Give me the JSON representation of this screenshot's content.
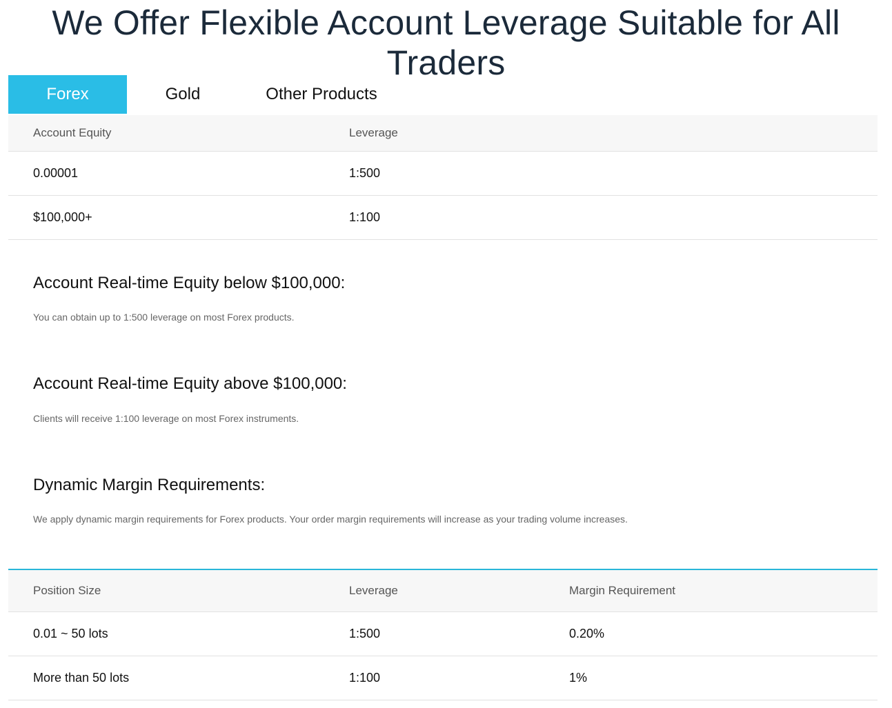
{
  "page": {
    "title": "We Offer Flexible Account Leverage Suitable for All Traders"
  },
  "tabs": [
    {
      "label": "Forex",
      "active": true
    },
    {
      "label": "Gold",
      "active": false
    },
    {
      "label": "Other Products",
      "active": false
    }
  ],
  "equity_table": {
    "headers": [
      "Account Equity",
      "Leverage"
    ],
    "rows": [
      [
        "0.00001",
        "1:500"
      ],
      [
        "$100,000+",
        "1:100"
      ]
    ]
  },
  "sections": [
    {
      "heading": "Account Real-time Equity below $100,000:",
      "text": "You can obtain up to 1:500 leverage on most Forex products."
    },
    {
      "heading": "Account Real-time Equity above $100,000:",
      "text": "Clients will receive 1:100 leverage on most Forex instruments."
    },
    {
      "heading": "Dynamic Margin Requirements:",
      "text": "We apply dynamic margin requirements for Forex products. Your order margin requirements will increase as your trading volume increases."
    }
  ],
  "margin_table": {
    "headers": [
      "Position Size",
      "Leverage",
      "Margin Requirement"
    ],
    "rows": [
      [
        "0.01 ~ 50 lots",
        "1:500",
        "0.20%"
      ],
      [
        "More than 50 lots",
        "1:100",
        "1%"
      ]
    ]
  },
  "colors": {
    "accent": "#2abde6",
    "title": "#1b2a3a",
    "header_bg": "#f7f7f7"
  }
}
